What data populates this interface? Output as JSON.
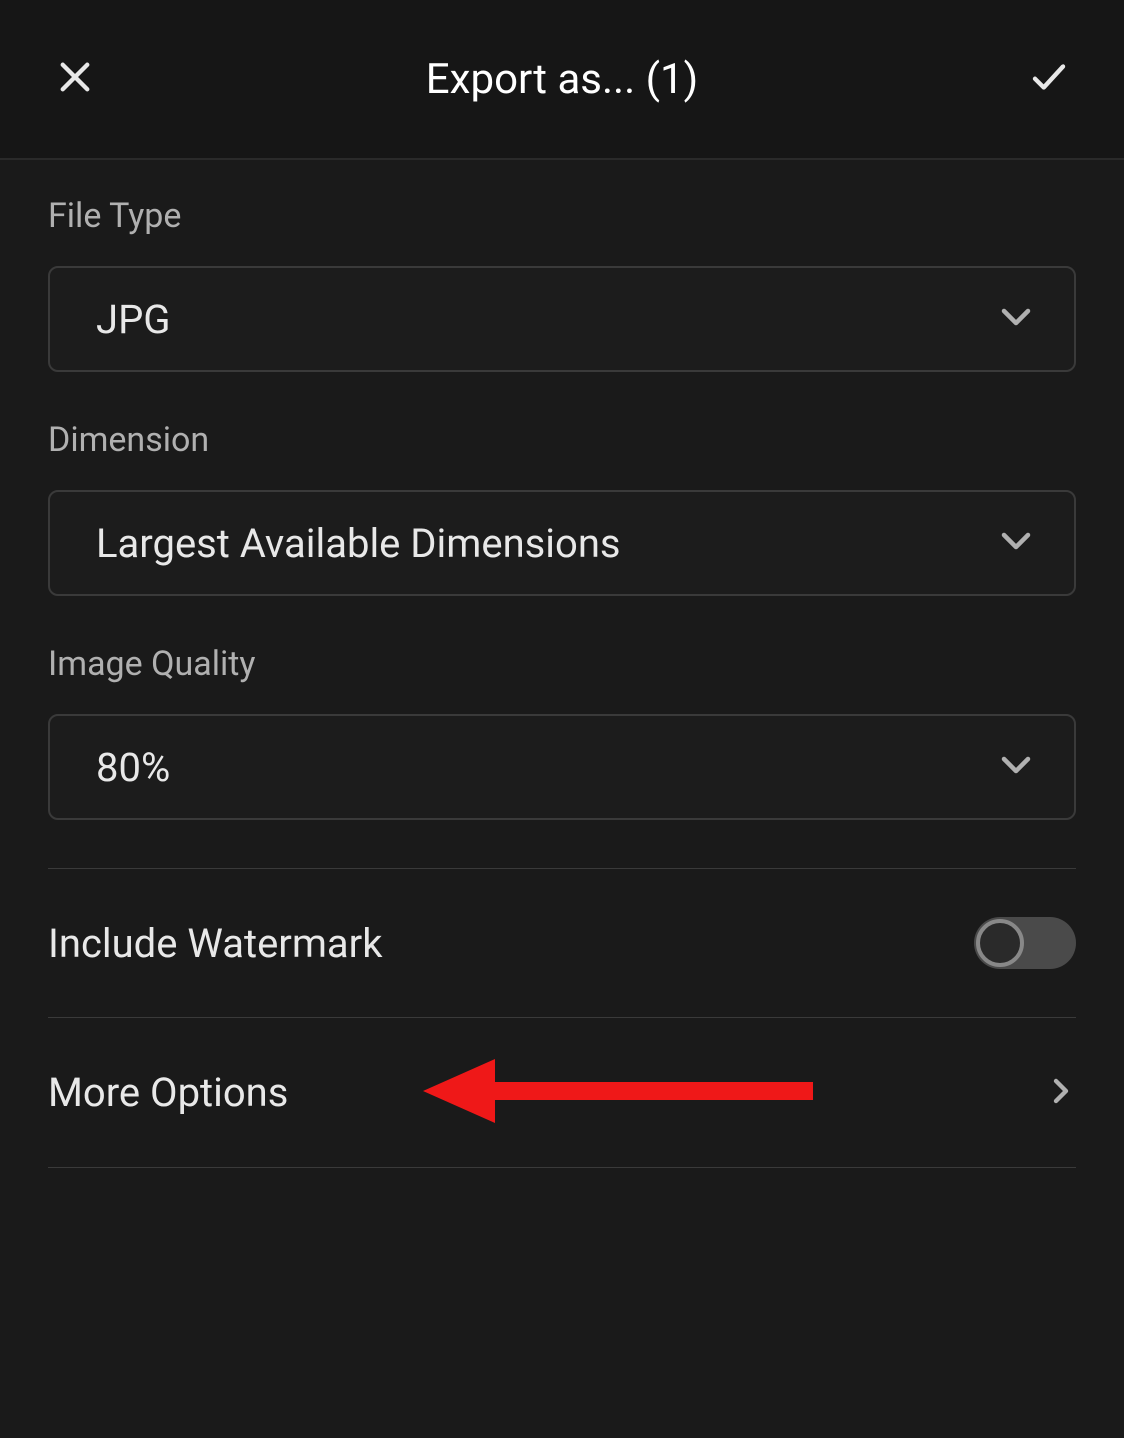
{
  "header": {
    "title": "Export as... (1)"
  },
  "fileType": {
    "label": "File Type",
    "value": "JPG"
  },
  "dimension": {
    "label": "Dimension",
    "value": "Largest Available Dimensions"
  },
  "imageQuality": {
    "label": "Image Quality",
    "value": "80%"
  },
  "watermark": {
    "label": "Include Watermark",
    "on": false
  },
  "moreOptions": {
    "label": "More Options"
  },
  "colors": {
    "bg": "#1a1a1a",
    "text": "#e8e8e8",
    "muted": "#b0b0b0",
    "border": "#3a3a3a",
    "annotation": "#ef1818"
  }
}
